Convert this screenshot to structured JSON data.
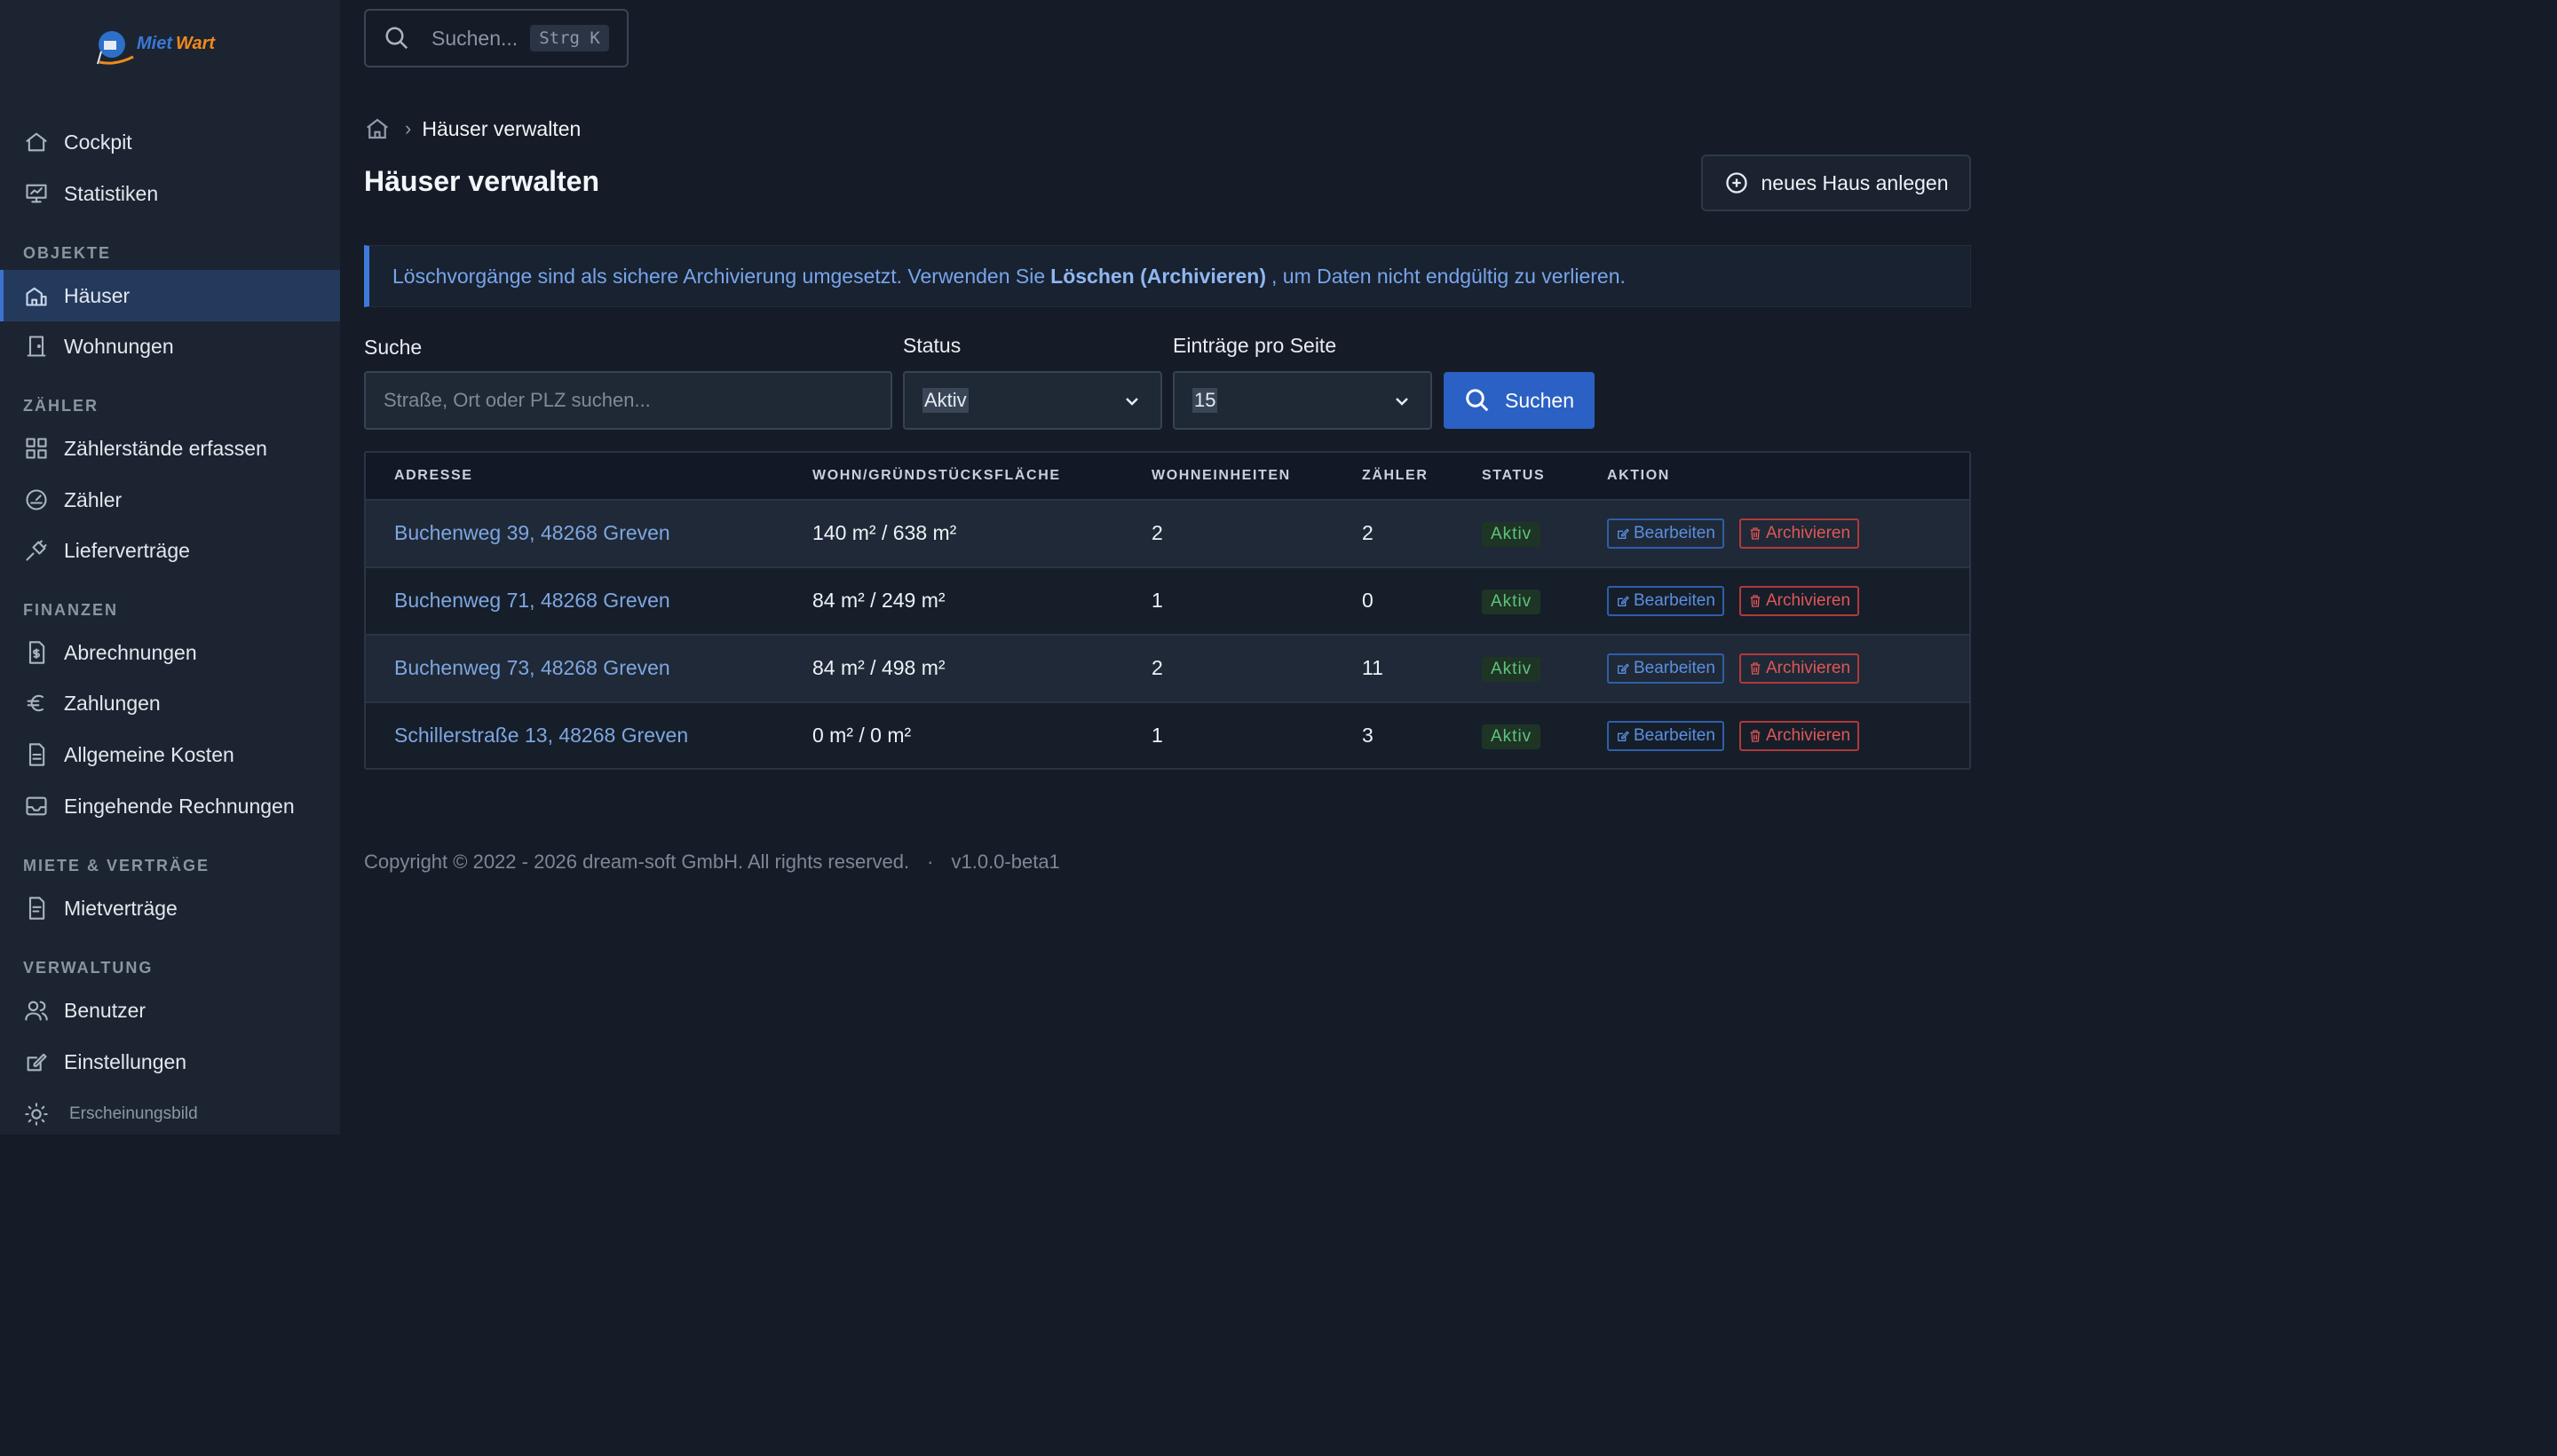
{
  "logo": {
    "part1": "Miet",
    "part2": "Wart"
  },
  "sidebar": {
    "items_top": [
      {
        "label": "Cockpit",
        "icon": "home-icon"
      },
      {
        "label": "Statistiken",
        "icon": "presentation-icon"
      }
    ],
    "section_objekte": "OBJEKTE",
    "items_objekte": [
      {
        "label": "Häuser",
        "icon": "building-icon",
        "active": true
      },
      {
        "label": "Wohnungen",
        "icon": "door-icon"
      }
    ],
    "section_zaehler": "ZÄHLER",
    "items_zaehler": [
      {
        "label": "Zählerstände erfassen",
        "icon": "grid-icon"
      },
      {
        "label": "Zähler",
        "icon": "gauge-icon"
      },
      {
        "label": "Lieferverträge",
        "icon": "plug-icon"
      }
    ],
    "section_finanzen": "FINANZEN",
    "items_finanzen": [
      {
        "label": "Abrechnungen",
        "icon": "invoice-icon"
      },
      {
        "label": "Zahlungen",
        "icon": "euro-icon"
      },
      {
        "label": "Allgemeine Kosten",
        "icon": "document-icon"
      },
      {
        "label": "Eingehende Rechnungen",
        "icon": "inbox-icon"
      }
    ],
    "section_miete": "MIETE & VERTRÄGE",
    "items_miete": [
      {
        "label": "Mietverträge",
        "icon": "contract-icon"
      }
    ],
    "section_verwaltung": "VERWALTUNG",
    "items_verwaltung": [
      {
        "label": "Benutzer",
        "icon": "users-icon"
      },
      {
        "label": "Einstellungen",
        "icon": "edit-icon"
      }
    ],
    "appearance": {
      "label": "Erscheinungsbild",
      "icon": "sun-icon"
    }
  },
  "topsearch": {
    "placeholder": "Suchen...",
    "shortcut": "Strg K"
  },
  "breadcrumb": {
    "current": "Häuser verwalten"
  },
  "page": {
    "title": "Häuser verwalten",
    "new_button": "neues Haus anlegen"
  },
  "alert": {
    "before": "Löschvorgänge sind als sichere Archivierung umgesetzt. Verwenden Sie",
    "bold": "Löschen (Archivieren)",
    "after": ", um Daten nicht endgültig zu verlieren."
  },
  "filters": {
    "search_label": "Suche",
    "search_placeholder": "Straße, Ort oder PLZ suchen...",
    "status_label": "Status",
    "status_value": "Aktiv",
    "perpage_label": "Einträge pro Seite",
    "perpage_value": "15",
    "search_button": "Suchen"
  },
  "table": {
    "headers": [
      "ADRESSE",
      "WOHN/GRÜNDSTÜCKSFLÄCHE",
      "WOHNEINHEITEN",
      "ZÄHLER",
      "STATUS",
      "AKTION"
    ],
    "rows": [
      {
        "address": "Buchenweg 39, 48268 Greven",
        "area": "140 m² / 638 m²",
        "units": "2",
        "meters": "2",
        "status": "Aktiv"
      },
      {
        "address": "Buchenweg 71, 48268 Greven",
        "area": "84 m² / 249 m²",
        "units": "1",
        "meters": "0",
        "status": "Aktiv"
      },
      {
        "address": "Buchenweg 73, 48268 Greven",
        "area": "84 m² / 498 m²",
        "units": "2",
        "meters": "11",
        "status": "Aktiv"
      },
      {
        "address": "Schillerstraße 13, 48268 Greven",
        "area": "0 m² / 0 m²",
        "units": "1",
        "meters": "3",
        "status": "Aktiv"
      }
    ],
    "edit_label": "Bearbeiten",
    "archive_label": "Archivieren"
  },
  "footer": {
    "copyright": "Copyright © 2022 - 2026 dream-soft GmbH. All rights reserved.",
    "separator": "·",
    "version": "v1.0.0-beta1"
  }
}
